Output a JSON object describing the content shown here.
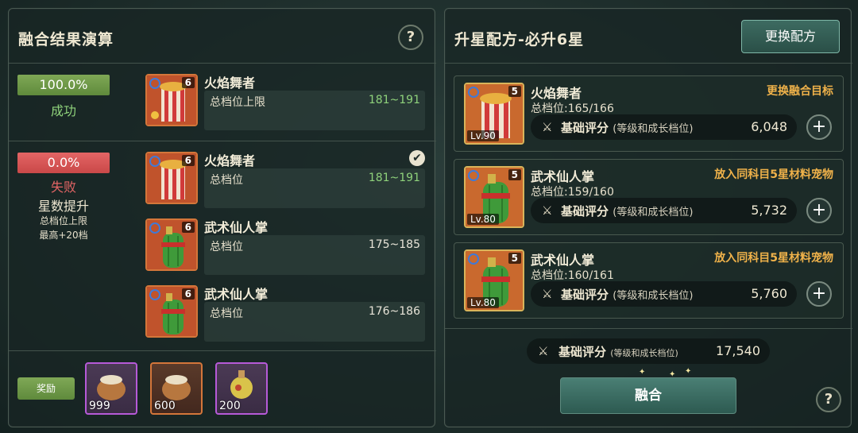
{
  "left": {
    "title": "融合结果演算",
    "help_label": "?",
    "success": {
      "rate": "100.0%",
      "status": "成功",
      "pet": {
        "name": "火焰舞者",
        "stars": "6",
        "stat_label": "总档位上限",
        "range": "181~191"
      }
    },
    "fail": {
      "rate": "0.0%",
      "status": "失败",
      "subtitle": "星数提升",
      "line1": "总档位上限",
      "line2": "最高+20档",
      "check": "✔",
      "pets": [
        {
          "name": "火焰舞者",
          "stars": "6",
          "stat_label": "总档位",
          "range": "181~191"
        },
        {
          "name": "武术仙人掌",
          "stars": "6",
          "stat_label": "总档位",
          "range": "175~185"
        },
        {
          "name": "武术仙人掌",
          "stars": "6",
          "stat_label": "总档位",
          "range": "176~186"
        }
      ]
    },
    "reward_label": "奖励",
    "rewards": [
      {
        "count": "999",
        "icon": "seed-sack-icon"
      },
      {
        "count": "600",
        "icon": "seed-sack-icon"
      },
      {
        "count": "200",
        "icon": "potion-bottle-icon"
      }
    ]
  },
  "right": {
    "title": "升星配方-必升6星",
    "change_recipe": "更换配方",
    "recipes": [
      {
        "name": "火焰舞者",
        "stars": "5",
        "level": "Lv.90",
        "sub": "总档位:165/166",
        "action": "更换融合目标",
        "score_label": "基础评分",
        "score_hint": "(等级和成长档位)",
        "score": "6,048"
      },
      {
        "name": "武术仙人掌",
        "stars": "5",
        "level": "Lv.80",
        "sub": "总档位:159/160",
        "action": "放入同科目5星材料宠物",
        "score_label": "基础评分",
        "score_hint": "(等级和成长档位)",
        "score": "5,732"
      },
      {
        "name": "武术仙人掌",
        "stars": "5",
        "level": "Lv.80",
        "sub": "总档位:160/161",
        "action": "放入同科目5星材料宠物",
        "score_label": "基础评分",
        "score_hint": "(等级和成长档位)",
        "score": "5,760"
      }
    ],
    "total": {
      "label": "基础评分",
      "hint": "(等级和成长档位)",
      "value": "17,540"
    },
    "fuse_label": "融合",
    "help_label": "?",
    "plus": "+"
  },
  "colors": {
    "success": "#6f9a49",
    "fail": "#d75555",
    "accent_orange": "#f0b24a",
    "range_green": "#8fd27b"
  }
}
